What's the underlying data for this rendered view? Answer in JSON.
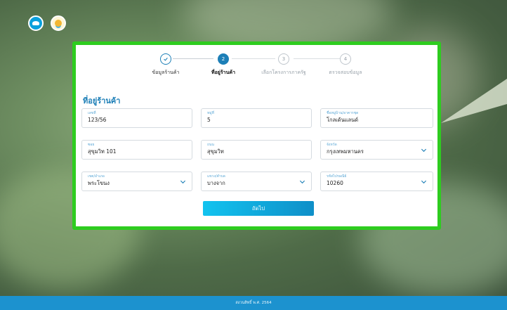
{
  "header": {
    "logos": [
      {
        "icon": "bank-logo-icon"
      },
      {
        "icon": "government-program-logo-icon"
      }
    ]
  },
  "stepper": {
    "steps": [
      {
        "number": "✓",
        "label": "ข้อมูลร้านค้า",
        "state": "done"
      },
      {
        "number": "2",
        "label": "ที่อยู่ร้านค้า",
        "state": "active"
      },
      {
        "number": "3",
        "label": "เลือกโครงการภาครัฐ",
        "state": "todo"
      },
      {
        "number": "4",
        "label": "ตรวจสอบข้อมูล",
        "state": "todo"
      }
    ]
  },
  "form": {
    "section_title": "ที่อยู่ร้านค้า",
    "fields": {
      "house_no": {
        "label": "เลขที่",
        "value": "123/56"
      },
      "moo": {
        "label": "หมู่ที่",
        "value": "5"
      },
      "village": {
        "label": "ชื่อหมู่บ้าน/อาคารชุด",
        "value": "โกลเด้นแลนด์"
      },
      "soi": {
        "label": "ซอย",
        "value": "สุขุมวิท 101"
      },
      "road": {
        "label": "ถนน",
        "value": "สุขุมวิท"
      },
      "province": {
        "label": "จังหวัด",
        "value": "กรุงเทพมหานคร"
      },
      "district": {
        "label": "เขต/อำเภอ",
        "value": "พระโขนง"
      },
      "subdistrict": {
        "label": "แขวง/ตำบล",
        "value": "บางจาก"
      },
      "postal_code": {
        "label": "รหัสไปรษณีย์",
        "value": "10260"
      }
    },
    "next_button": "ถัดไป"
  },
  "footer": {
    "text": "สงวนสิทธิ์ พ.ศ. 2564"
  },
  "colors": {
    "accent": "#1d7fb7",
    "highlight_border": "#2ecc1f",
    "button_start": "#12c3ef",
    "button_end": "#0f8fc8",
    "footer": "#1c92cf"
  }
}
